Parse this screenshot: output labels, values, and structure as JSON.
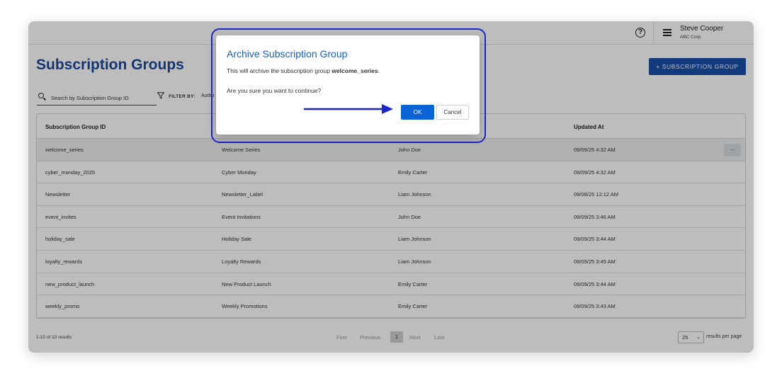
{
  "header": {
    "user_name": "Steve Cooper",
    "user_org": "ABC Corp",
    "help_icon": "question-circle-icon",
    "menu_icon": "hamburger-menu-icon"
  },
  "page": {
    "title": "Subscription Groups",
    "add_button_label": "+ SUBSCRIPTION GROUP"
  },
  "search": {
    "placeholder": "Search by Subscription Group ID"
  },
  "filter": {
    "label": "FILTER BY:",
    "value": "Autho"
  },
  "table": {
    "columns": [
      "Subscription Group ID",
      "Updated At"
    ],
    "rows": [
      {
        "id": "welcome_series",
        "name": "Welcome Series",
        "author": "John Doe",
        "updated": "09/09/25 4:32 AM",
        "action": "..."
      },
      {
        "id": "cyber_monday_2025",
        "name": "Cyber Monday",
        "author": "Emily Carter",
        "updated": "09/09/25 4:32 AM"
      },
      {
        "id": "Newsletter",
        "name": "Newsletter_Label",
        "author": "Liam Johnson",
        "updated": "09/08/25 12:12 AM"
      },
      {
        "id": "event_invites",
        "name": "Event Invitations",
        "author": "John Doe",
        "updated": "09/09/25 3:46 AM"
      },
      {
        "id": "holiday_sale",
        "name": "Holiday Sale",
        "author": "Liam Johnson",
        "updated": "09/09/25 3:44 AM"
      },
      {
        "id": "loyalty_rewards",
        "name": "Loyalty Rewards",
        "author": "Liam Johnson",
        "updated": "09/09/25 3:45 AM"
      },
      {
        "id": "new_product_launch",
        "name": "New Product Launch",
        "author": "Emily Carter",
        "updated": "09/09/25 3:44 AM"
      },
      {
        "id": "weekly_promo",
        "name": "Weekly Promotions",
        "author": "Emily Carter",
        "updated": "09/09/25 3:43 AM"
      }
    ]
  },
  "footer": {
    "results_text": "1-10 of 10 results",
    "first": "First",
    "previous": "Previous",
    "current_page": "1",
    "next": "Next",
    "last": "Last",
    "per_page_value": "25",
    "per_page_label": "results per page"
  },
  "modal": {
    "title": "Archive Subscription Group",
    "message_prefix": "This will archive the subscription group ",
    "group_name": "welcome_series",
    "message_suffix": ".",
    "confirm": "Are you sure you want to continue?",
    "ok_label": "OK",
    "cancel_label": "Cancel",
    "highlight_color": "#1c27c9"
  }
}
